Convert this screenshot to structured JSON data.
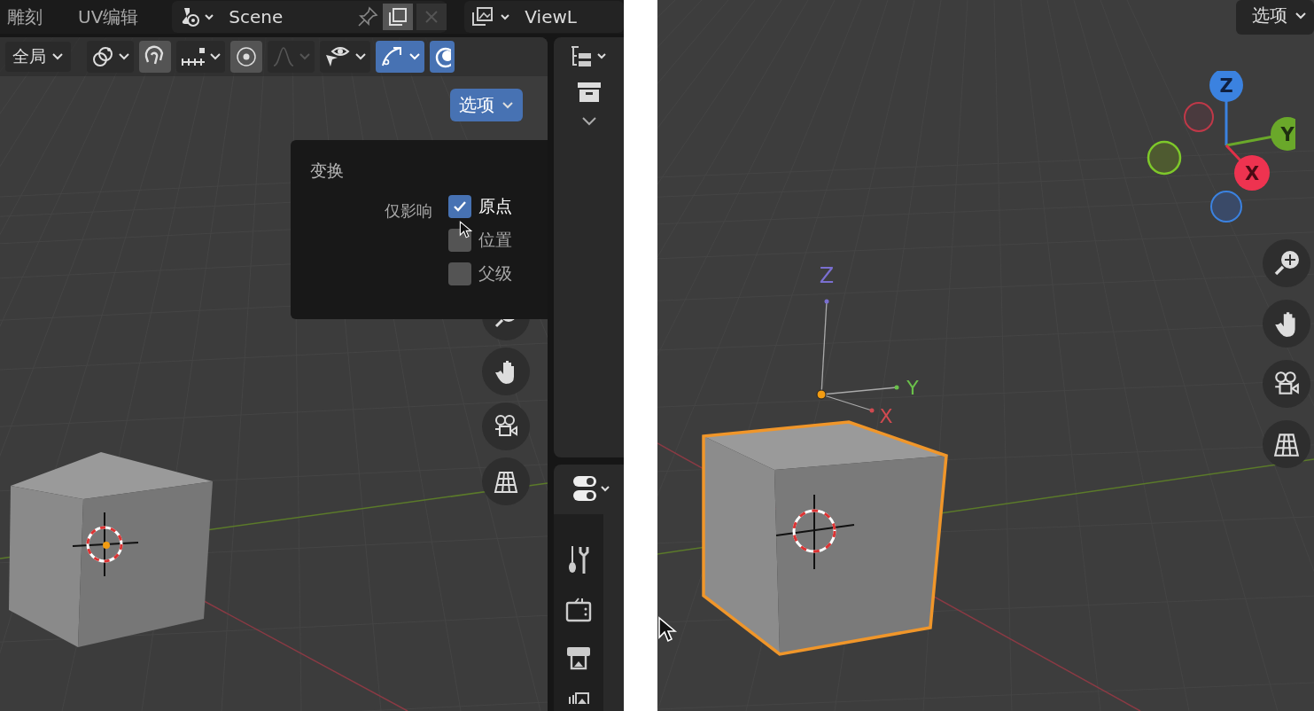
{
  "left": {
    "workspace_tabs": [
      {
        "label": "雕刻"
      },
      {
        "label": "UV编辑"
      }
    ],
    "scene_field": {
      "value": "Scene"
    },
    "view_layer_field": {
      "value": "ViewL"
    },
    "transform_orientation": {
      "label": "全局"
    },
    "tools": [
      {
        "kind": "pivot",
        "on": false,
        "disabled": false,
        "has_menu": true
      },
      {
        "kind": "magnet",
        "on": true,
        "disabled": false,
        "has_menu": false
      },
      {
        "kind": "increment",
        "on": false,
        "disabled": false,
        "has_menu": true
      },
      {
        "kind": "proportional",
        "on": true,
        "disabled": false,
        "has_menu": false
      },
      {
        "kind": "falloff",
        "on": false,
        "disabled": true,
        "has_menu": true
      },
      {
        "kind": "select",
        "on": false,
        "disabled": false,
        "has_menu": true
      },
      {
        "kind": "gizmo",
        "on": true,
        "disabled": false,
        "has_menu": true
      },
      {
        "kind": "overlay",
        "on": true,
        "disabled": false,
        "has_menu": false
      }
    ],
    "options_button": {
      "label": "选项",
      "open": true
    },
    "popover": {
      "title": "变换",
      "row_label": "仅影响",
      "checkboxes": [
        {
          "label": "原点",
          "checked": true
        },
        {
          "label": "位置",
          "checked": false
        },
        {
          "label": "父级",
          "checked": false
        }
      ]
    },
    "cube": {
      "selected": false
    }
  },
  "right": {
    "options_button": {
      "label": "选项",
      "open": false
    },
    "gizmo_axes": [
      {
        "label": "Z"
      },
      {
        "label": "Y"
      },
      {
        "label": "X"
      }
    ],
    "origin_axes": [
      {
        "label": "Z"
      },
      {
        "label": "Y"
      },
      {
        "label": "X"
      }
    ],
    "cube": {
      "selected": true
    }
  }
}
